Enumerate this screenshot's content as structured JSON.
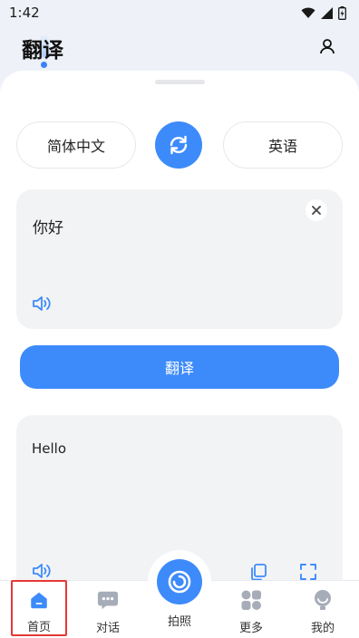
{
  "status_bar": {
    "time": "1:42"
  },
  "header": {
    "title": "翻译"
  },
  "languages": {
    "source": "简体中文",
    "target": "英语"
  },
  "input": {
    "text": "你好"
  },
  "translate_button": {
    "label": "翻译"
  },
  "output": {
    "text": "Hello"
  },
  "tabs": [
    {
      "label": "首页",
      "icon": "home-icon",
      "active": true
    },
    {
      "label": "对话",
      "icon": "chat-icon"
    },
    {
      "label": "拍照",
      "icon": "camera-icon"
    },
    {
      "label": "更多",
      "icon": "grid-icon"
    },
    {
      "label": "我的",
      "icon": "user-icon"
    }
  ],
  "colors": {
    "accent": "#3d8bfa",
    "card": "#f2f3f5",
    "highlight": "#e53935"
  }
}
